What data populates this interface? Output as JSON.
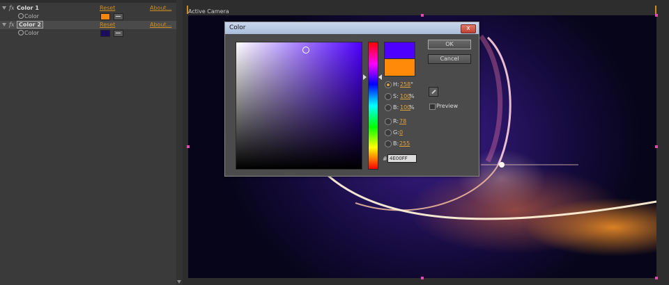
{
  "effects_panel": {
    "effects": [
      {
        "name": "Color 1",
        "reset": "Reset",
        "about": "About...",
        "prop_label": "Color",
        "swatch": "#f7860f"
      },
      {
        "name": "Color 2",
        "reset": "Reset",
        "about": "About...",
        "prop_label": "Color",
        "swatch": "#1c0c5e"
      }
    ]
  },
  "viewer": {
    "label": "Active Camera"
  },
  "color_dialog": {
    "title": "Color",
    "close_glyph": "x",
    "ok_label": "OK",
    "cancel_label": "Cancel",
    "preview_label": "Preview",
    "hue_slider_colors": "rainbow",
    "new_color": "#4e00ff",
    "original_color": "#ff8a0a",
    "fields": {
      "h": {
        "label": "H:",
        "value": "258",
        "unit": "°"
      },
      "s": {
        "label": "S:",
        "value": "100",
        "unit": "%"
      },
      "b": {
        "label": "B:",
        "value": "100",
        "unit": "%"
      },
      "r": {
        "label": "R:",
        "value": "78"
      },
      "g": {
        "label": "G:",
        "value": "0"
      },
      "b2": {
        "label": "B:",
        "value": "255"
      }
    },
    "hex_prefix": "#",
    "hex_value": "4E00FF"
  }
}
